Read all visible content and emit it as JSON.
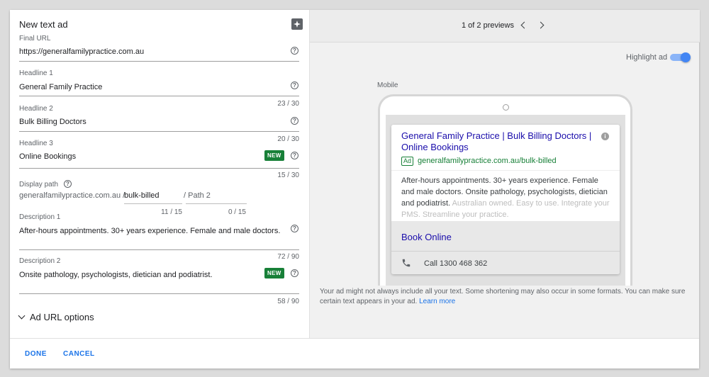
{
  "editor": {
    "title": "New text ad",
    "final_url": {
      "label": "Final URL",
      "value": "https://generalfamilypractice.com.au"
    },
    "headline1": {
      "label": "Headline 1",
      "value": "General Family Practice",
      "counter": "23 / 30"
    },
    "headline2": {
      "label": "Headline 2",
      "value": "Bulk Billing Doctors",
      "counter": "20 / 30"
    },
    "headline3": {
      "label": "Headline 3",
      "value": "Online Bookings",
      "counter": "15 / 30",
      "badge": "NEW"
    },
    "display_path": {
      "label": "Display path",
      "domain": "generalfamilypractice.com.au /",
      "path1": "bulk-billed",
      "path1_counter": "11 / 15",
      "path2_placeholder": "/ Path 2",
      "path2_counter": "0 / 15"
    },
    "description1": {
      "label": "Description 1",
      "value": "After-hours appointments. 30+ years experience. Female and male doctors.",
      "counter": "72 / 90"
    },
    "description2": {
      "label": "Description 2",
      "value": "Onsite pathology, psychologists, dietician and podiatrist.",
      "counter": "58 / 90",
      "badge": "NEW"
    },
    "ad_url_options": "Ad URL options"
  },
  "preview": {
    "count_text": "1 of 2 previews",
    "highlight_label": "Highlight ad",
    "highlight_on": true,
    "device_label": "Mobile",
    "ad": {
      "headline": "General Family Practice | Bulk Billing Doctors | Online Bookings",
      "ad_tag": "Ad",
      "display_url": "generalfamilypractice.com.au/bulk-billed",
      "description": "After-hours appointments. 30+ years experience. Female and male doctors. Onsite pathology, psychologists, dietician and podiatrist.",
      "description_faded": "Australian owned. Easy to use. Integrate your PMS. Streamline your practice.",
      "sitelink": "Book Online",
      "call": "Call 1300 468 362"
    },
    "note": "Your ad might not always include all your text. Some shortening may also occur in some formats. You can make sure certain text appears in your ad.",
    "learn_more": "Learn more"
  },
  "footer": {
    "done": "DONE",
    "cancel": "CANCEL"
  },
  "colors": {
    "accent": "#1a73e8",
    "badge": "#188038",
    "ad_link": "#1a0dab"
  }
}
